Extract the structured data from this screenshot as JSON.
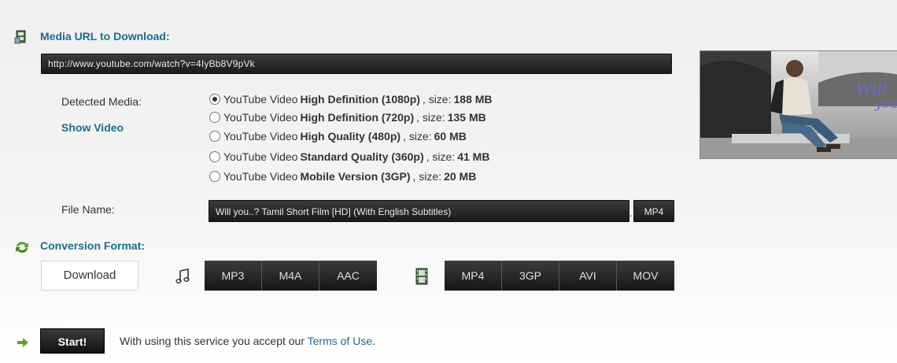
{
  "media_url": {
    "title": "Media URL to Download:",
    "value": "http://www.youtube.com/watch?v=4IyBb8V9pVk"
  },
  "detected_media": {
    "label": "Detected Media:",
    "show_video": "Show Video",
    "options": [
      {
        "prefix": "YouTube Video",
        "quality": "High Definition (1080p)",
        "size_label": ", size:",
        "size": "188 MB",
        "selected": true
      },
      {
        "prefix": "YouTube Video",
        "quality": "High Definition (720p)",
        "size_label": ", size:",
        "size": "135 MB",
        "selected": false
      },
      {
        "prefix": "YouTube Video",
        "quality": "High Quality (480p)",
        "size_label": ", size:",
        "size": "60 MB",
        "selected": false
      },
      {
        "prefix": "YouTube Video",
        "quality": "Standard Quality (360p)",
        "size_label": ", size:",
        "size": "41 MB",
        "selected": false
      },
      {
        "prefix": "YouTube Video",
        "quality": "Mobile Version (3GP)",
        "size_label": ", size:",
        "size": "20 MB",
        "selected": false
      }
    ]
  },
  "file_name": {
    "label": "File Name:",
    "value": "Will you..? Tamil Short Film [HD] (With English Subtitles)",
    "separator": ".",
    "extension": "MP4"
  },
  "conversion": {
    "title": "Conversion Format:",
    "download_label": "Download",
    "audio_icon": "music-note-icon",
    "video_icon": "film-strip-icon",
    "audio_formats": [
      "MP3",
      "M4A",
      "AAC"
    ],
    "video_formats": [
      "MP4",
      "3GP",
      "AVI",
      "MOV"
    ]
  },
  "footer": {
    "start_label": "Start!",
    "terms_prefix": "With using this service you accept our ",
    "terms_link": "Terms of Use",
    "terms_suffix": "."
  },
  "icons": {
    "media_url": "film-icon",
    "conversion": "refresh-arrows-icon",
    "start": "arrow-right-icon"
  },
  "colors": {
    "accent": "#1f6c8c",
    "dark_button": "#222222",
    "arrow_green": "#5ca52b"
  }
}
